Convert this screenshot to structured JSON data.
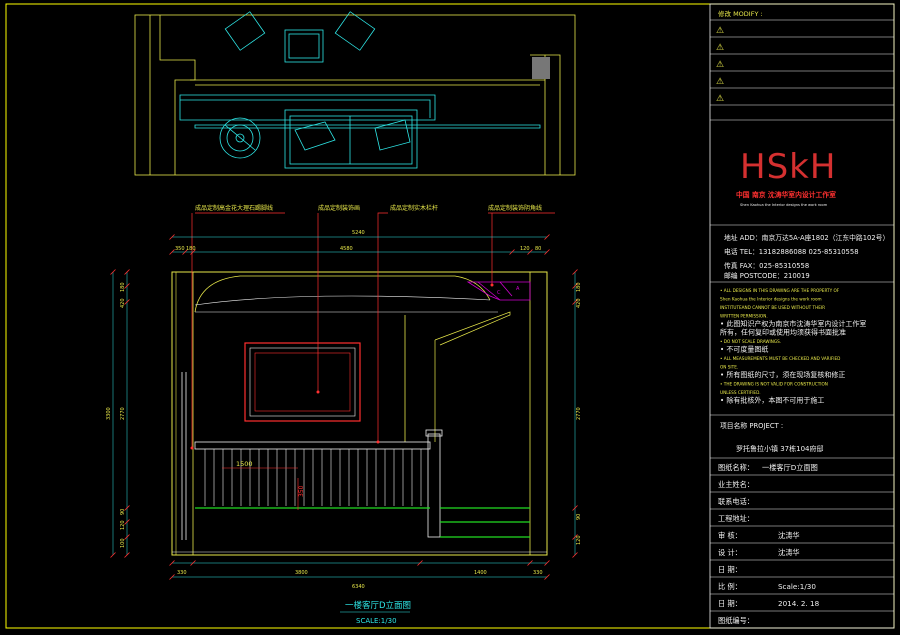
{
  "palette": {
    "background": "#000000",
    "frame": "#ffff00",
    "plan_lines": "#2ee6e6",
    "wall": "#e8e84a",
    "annotation": "#ff3030",
    "magenta": "#d000d0",
    "green": "#22dd22",
    "white": "#f0f0f0"
  },
  "labels": {
    "label1": "成品定制高金花大理石踢脚线",
    "label2": "成品定制装饰画",
    "label3": "成品定制实木栏杆",
    "label4": "成品定制装饰阴角线"
  },
  "dims": {
    "top_total": "5240",
    "top_segments": [
      "350",
      "180",
      "4580",
      "120",
      "80"
    ],
    "bottom_total": "6340",
    "bottom_segments": [
      "330",
      "3800",
      "1400",
      "330"
    ],
    "left_total": "3300",
    "left_segments": [
      "180",
      "420",
      "2770",
      "90",
      "120",
      "100"
    ],
    "right_segments": [
      "180",
      "420",
      "2770",
      "90",
      "120"
    ],
    "rail_width": "1500",
    "rail_height": "350"
  },
  "drawing_title": "一楼客厅D立面图",
  "drawing_scale": "SCALE:1/30",
  "title_block": {
    "modify_label": "修改 MODIFY :",
    "warning_glyph": "⚠",
    "logo_text": "HSkH",
    "studio_name": "中国 南京 沈涛华室内设计工作室",
    "studio_slogan": "Shen Kaohua the Interior designs the work room",
    "address": "地址 ADD：南京万达5A-A座1802（江东中路102号）",
    "phone": "电话 TEL：13182886088    025-85310558",
    "fax": "传真 FAX：025-85310558",
    "postcode": "邮编 POSTCODE：210019",
    "notes": [
      "• ALL DESIGNS IN THIS DRAWING ARE THE PROPERTY OF",
      "  Shen Kaohua the Interior designs the work room",
      "  INSTITUTEAND CANNOT BE USED WITHOUT THEIR",
      "  WRITTEN PERMISSION.",
      "• 此图知识产权为南京市沈涛华室内设计工作室",
      "  所有，任何复印或使用均须获得书面批准",
      "• DO NOT SCALE DRAWINGS.",
      "• 不可度量图纸",
      "• ALL MEASUREMENTS MUST BE CHECKED AND VARIFIED",
      "  ON SITE.",
      "• 所有图纸的尺寸，须在现场复核和修正",
      "• THE DRAWING IS NOT VALID FOR CONSTRUCTION",
      "  UNLESS CERTIFIED.",
      "• 除有批核外，本图不可用于施工"
    ],
    "project_label": "项目名称 PROJECT :",
    "project_name": "罗托鲁拉小镇 37栋104府邸",
    "drawing_name_label": "图纸名称：",
    "drawing_name": "一楼客厅D立面图",
    "owner_label": "业主姓名：",
    "contact_label": "联系电话：",
    "site_label": "工程地址：",
    "review_label": "审    核：",
    "review_value": "沈涛华",
    "design_label": "设    计：",
    "design_value": "沈涛华",
    "date_label": "日    期：",
    "scale_label": "比    例：",
    "scale_value": "Scale:1/30",
    "issue_label": "日    期：",
    "issue_value": "2014. 2. 18",
    "number_label": "图纸编号："
  }
}
